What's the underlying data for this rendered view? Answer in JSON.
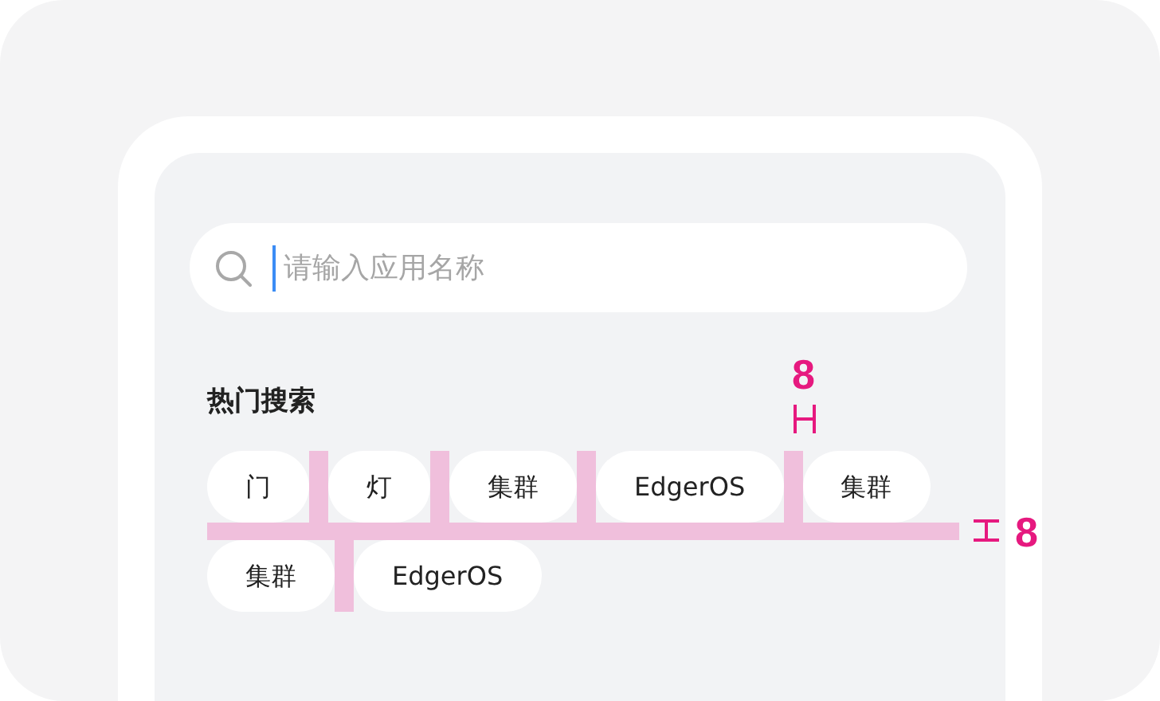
{
  "search": {
    "placeholder": "请输入应用名称"
  },
  "hot_search": {
    "title": "热门搜索",
    "tag_rows": [
      {
        "tags": [
          "门",
          "灯",
          "集群",
          "EdgerOS",
          "集群"
        ]
      },
      {
        "tags": [
          "集群",
          "EdgerOS"
        ]
      }
    ]
  },
  "spacing_annotations": {
    "column_gap": "8",
    "row_gap": "8"
  }
}
